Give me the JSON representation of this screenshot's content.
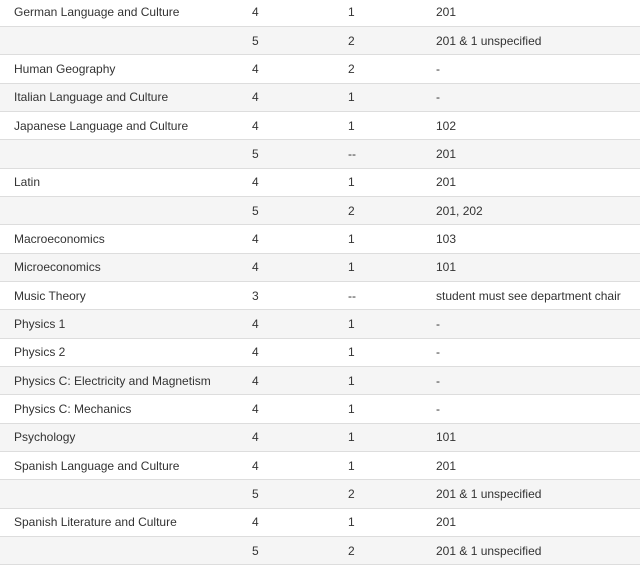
{
  "table": {
    "rows": [
      [
        "German Language and Culture",
        "4",
        "1",
        "201"
      ],
      [
        "",
        "5",
        "2",
        "201 & 1 unspecified"
      ],
      [
        "Human Geography",
        "4",
        "2",
        "-"
      ],
      [
        "Italian Language and Culture",
        "4",
        "1",
        "-"
      ],
      [
        "Japanese Language and Culture",
        "4",
        "1",
        "102"
      ],
      [
        "",
        "5",
        "--",
        "201"
      ],
      [
        "Latin",
        "4",
        "1",
        "201"
      ],
      [
        "",
        "5",
        "2",
        "201, 202"
      ],
      [
        "Macroeconomics",
        "4",
        "1",
        "103"
      ],
      [
        "Microeconomics",
        "4",
        "1",
        "101"
      ],
      [
        "Music Theory",
        "3",
        "--",
        "student must see department chair"
      ],
      [
        "Physics 1",
        "4",
        "1",
        "-"
      ],
      [
        "Physics 2",
        "4",
        "1",
        "-"
      ],
      [
        "Physics C: Electricity and Magnetism",
        "4",
        "1",
        "-"
      ],
      [
        "Physics C: Mechanics",
        "4",
        "1",
        "-"
      ],
      [
        "Psychology",
        "4",
        "1",
        "101"
      ],
      [
        "Spanish Language and Culture",
        "4",
        "1",
        "201"
      ],
      [
        "",
        "5",
        "2",
        "201 & 1 unspecified"
      ],
      [
        "Spanish Literature and Culture",
        "4",
        "1",
        "201"
      ],
      [
        "",
        "5",
        "2",
        "201 & 1 unspecified"
      ]
    ]
  },
  "colors": {
    "stripe": "#f5f5f5",
    "border": "#dddddd",
    "text": "#333333"
  }
}
